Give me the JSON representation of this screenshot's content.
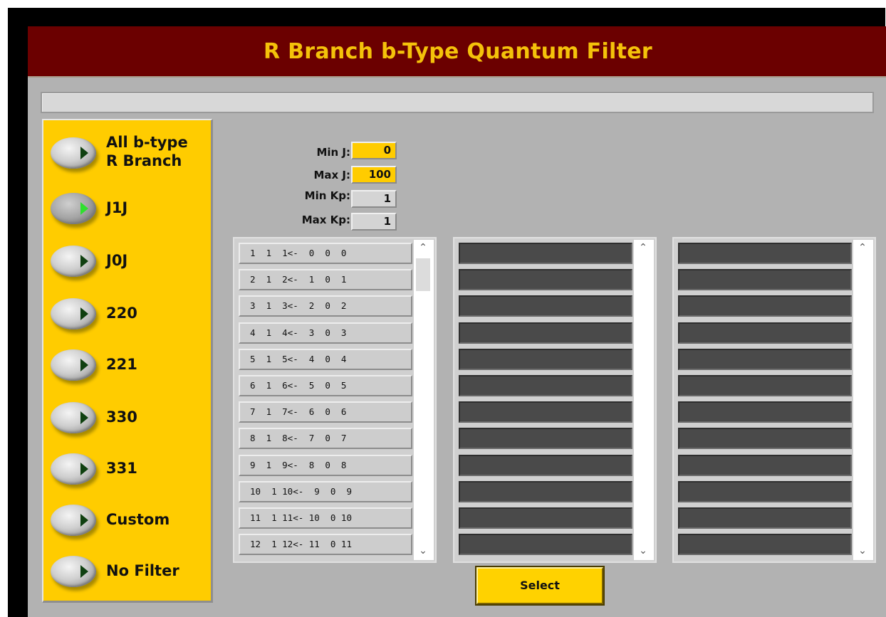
{
  "window": {
    "title": "R Branch b-Type Quantum Filter",
    "status_text": ""
  },
  "filters": {
    "selected": "J1J",
    "options": [
      {
        "label": "All b-type\nR Branch"
      },
      {
        "label": "J1J"
      },
      {
        "label": "J0J"
      },
      {
        "label": "220"
      },
      {
        "label": "221"
      },
      {
        "label": "330"
      },
      {
        "label": "331"
      },
      {
        "label": "Custom"
      },
      {
        "label": "No Filter"
      }
    ]
  },
  "params": {
    "min_j_label": "Min J:",
    "min_j": "0",
    "max_j_label": "Max J:",
    "max_j": "100",
    "min_kp_label": "Min Kp:",
    "min_kp": "1",
    "max_kp_label": "Max Kp:",
    "max_kp": "1"
  },
  "list1": {
    "rows": [
      "1  1  1<-  0  0  0",
      "2  1  2<-  1  0  1",
      "3  1  3<-  2  0  2",
      "4  1  4<-  3  0  3",
      "5  1  5<-  4  0  4",
      "6  1  6<-  5  0  5",
      "7  1  7<-  6  0  6",
      "8  1  8<-  7  0  7",
      "9  1  9<-  8  0  8",
      "10  1 10<-  9  0  9",
      "11  1 11<- 10  0 10",
      "12  1 12<- 11  0 11"
    ]
  },
  "list2": {
    "rows": [
      "",
      "",
      "",
      "",
      "",
      "",
      "",
      "",
      "",
      "",
      "",
      ""
    ]
  },
  "list3": {
    "rows": [
      "",
      "",
      "",
      "",
      "",
      "",
      "",
      "",
      "",
      "",
      "",
      ""
    ]
  },
  "select_button": {
    "label": "Select"
  },
  "colors": {
    "title_bar": "#6b0000",
    "title_text": "#f4c20a",
    "sidebar": "#ffcc00",
    "panel": "#b2b2b2",
    "active_led_arrow": "#2ee02e"
  },
  "icons": {
    "scroll_up": "▲",
    "scroll_down": "▼"
  }
}
